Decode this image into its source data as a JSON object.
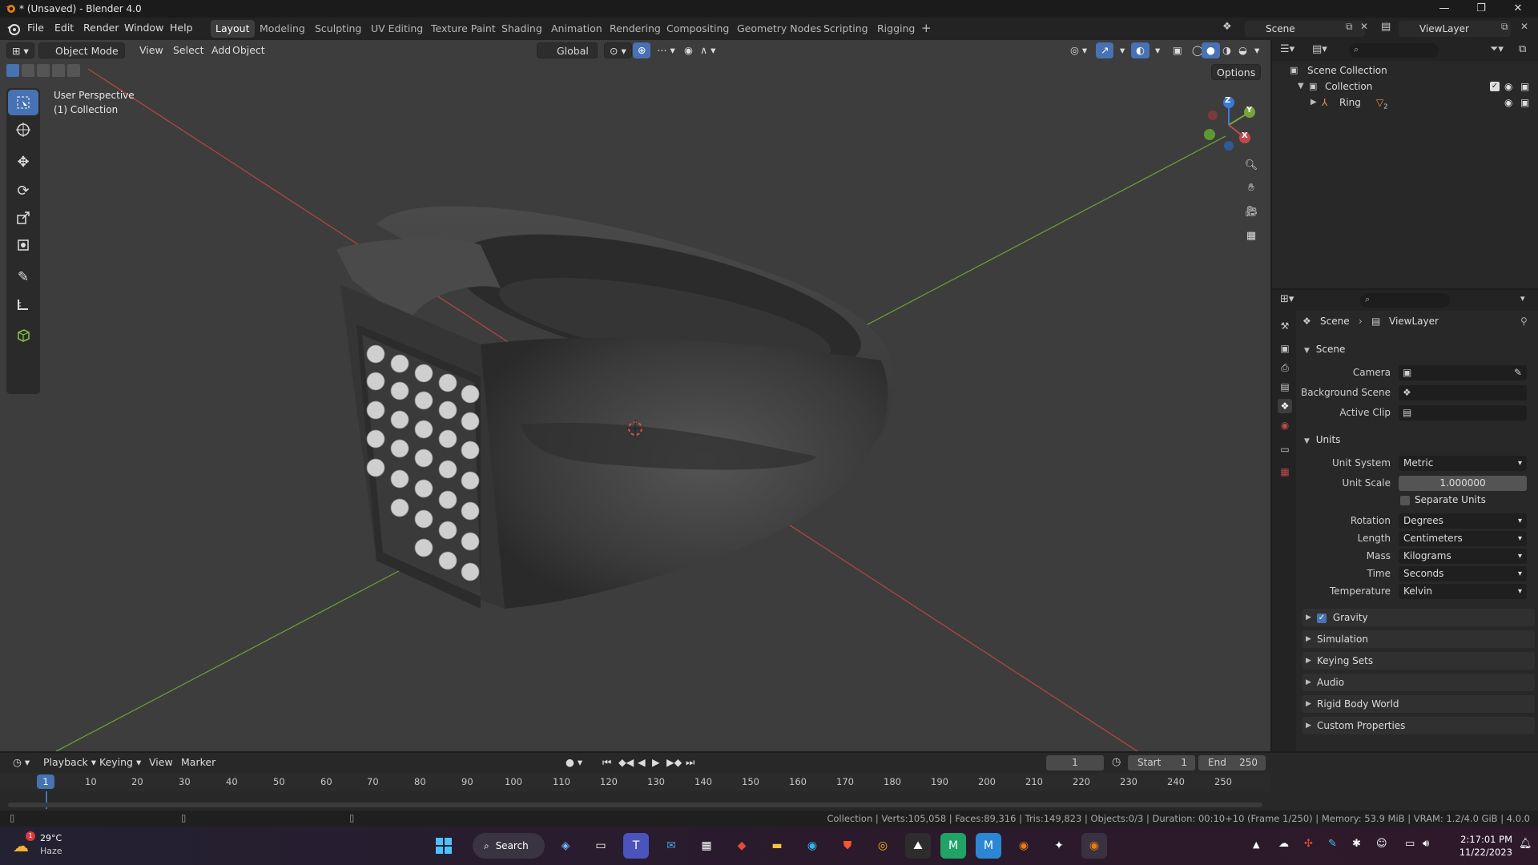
{
  "window": {
    "title": "* (Unsaved) - Blender 4.0",
    "controls": [
      "—",
      "❐",
      "✕"
    ]
  },
  "menu": [
    "File",
    "Edit",
    "Render",
    "Window",
    "Help"
  ],
  "workspaces": [
    "Layout",
    "Modeling",
    "Sculpting",
    "UV Editing",
    "Texture Paint",
    "Shading",
    "Animation",
    "Rendering",
    "Compositing",
    "Geometry Nodes",
    "Scripting",
    "Rigging"
  ],
  "active_workspace": "Layout",
  "scene_field": "Scene",
  "viewlayer_field": "ViewLayer",
  "viewport": {
    "mode": "Object Mode",
    "menus": [
      "View",
      "Select",
      "Add",
      "Object"
    ],
    "transform_orientation": "Global",
    "options_label": "Options",
    "overlay_line1": "User Perspective",
    "overlay_line2": "(1) Collection",
    "gizmo_axes": [
      "Z",
      "Y",
      "X"
    ]
  },
  "outliner": {
    "root": "Scene Collection",
    "collection": "Collection",
    "object": "Ring",
    "object_badge": "2"
  },
  "properties": {
    "breadcrumb_scene": "Scene",
    "breadcrumb_viewlayer": "ViewLayer",
    "scene_panel": "Scene",
    "camera_label": "Camera",
    "background_scene_label": "Background Scene",
    "active_clip_label": "Active Clip",
    "units_panel": "Units",
    "unit_system_label": "Unit System",
    "unit_system": "Metric",
    "unit_scale_label": "Unit Scale",
    "unit_scale": "1.000000",
    "separate_units_label": "Separate Units",
    "rotation_label": "Rotation",
    "rotation": "Degrees",
    "length_label": "Length",
    "length": "Centimeters",
    "mass_label": "Mass",
    "mass": "Kilograms",
    "time_label": "Time",
    "time": "Seconds",
    "temperature_label": "Temperature",
    "temperature": "Kelvin",
    "collapsed_panels": [
      "Gravity",
      "Simulation",
      "Keying Sets",
      "Audio",
      "Rigid Body World",
      "Custom Properties"
    ]
  },
  "timeline": {
    "menus": [
      "Playback",
      "Keying",
      "View",
      "Marker"
    ],
    "current_frame": "1",
    "start_label": "Start",
    "start": "1",
    "end_label": "End",
    "end": "250",
    "ticks": [
      "1",
      "10",
      "20",
      "30",
      "40",
      "50",
      "60",
      "70",
      "80",
      "90",
      "100",
      "110",
      "120",
      "130",
      "140",
      "150",
      "160",
      "170",
      "180",
      "190",
      "200",
      "210",
      "220",
      "230",
      "240",
      "250"
    ]
  },
  "statusbar": "Collection | Verts:105,058 | Faces:89,316 | Tris:149,823 | Objects:0/3 | Duration: 00:10+10 (Frame 1/250) | Memory: 53.9 MiB | VRAM: 1.2/4.0 GiB | 4.0.0",
  "taskbar": {
    "weather_temp": "29°C",
    "weather_desc": "Haze",
    "weather_badge": "1",
    "search_label": "Search",
    "time": "2:17:01 PM",
    "date": "11/22/2023"
  },
  "colors": {
    "accent": "#4772b3",
    "viewport_bg": "#3d3d3d",
    "panel_bg": "#282828",
    "x_axis": "#c04a4a",
    "y_axis": "#7aa23a"
  }
}
